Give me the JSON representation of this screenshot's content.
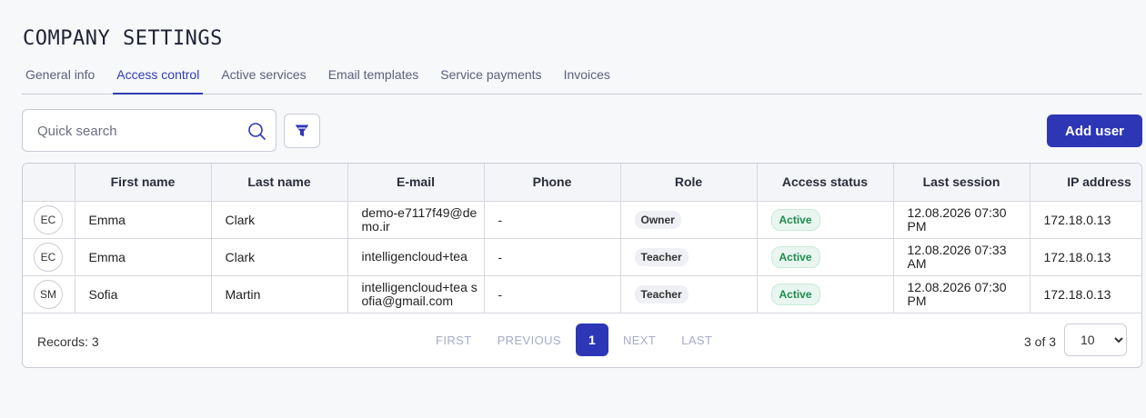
{
  "page_title": "COMPANY SETTINGS",
  "tabs": [
    {
      "label": "General info"
    },
    {
      "label": "Access control"
    },
    {
      "label": "Active services"
    },
    {
      "label": "Email templates"
    },
    {
      "label": "Service payments"
    },
    {
      "label": "Invoices"
    }
  ],
  "active_tab": "Access control",
  "search": {
    "placeholder": "Quick search",
    "value": ""
  },
  "add_user_label": "Add user",
  "table": {
    "headers": [
      "First name",
      "Last name",
      "E-mail",
      "Phone",
      "Role",
      "Access status",
      "Last session",
      "IP address"
    ],
    "rows": [
      {
        "initials": "EC",
        "first": "Emma",
        "last": "Clark",
        "email": "demo-e7117f49@demo.ir",
        "phone": "-",
        "role": "Owner",
        "status": "Active",
        "session": "12.08.2026 07:30 PM",
        "ip": "172.18.0.13"
      },
      {
        "initials": "EC",
        "first": "Emma",
        "last": "Clark",
        "email": "intelligencloud+tea",
        "phone": "-",
        "role": "Teacher",
        "status": "Active",
        "session": "12.08.2026 07:33 AM",
        "ip": "172.18.0.13"
      },
      {
        "initials": "SM",
        "first": "Sofia",
        "last": "Martin",
        "email": "intelligencloud+tea sofia@gmail.com",
        "phone": "-",
        "role": "Teacher",
        "status": "Active",
        "session": "12.08.2026 07:30 PM",
        "ip": "172.18.0.13"
      }
    ]
  },
  "footer": {
    "records": "Records: 3",
    "pager": {
      "first": "FIRST",
      "previous": "PREVIOUS",
      "current": "1",
      "next": "NEXT",
      "last": "LAST"
    },
    "range": "3 of 3",
    "page_size": "10"
  },
  "colors": {
    "accent": "#2d37b6",
    "active_green": "#1f8a4f"
  }
}
